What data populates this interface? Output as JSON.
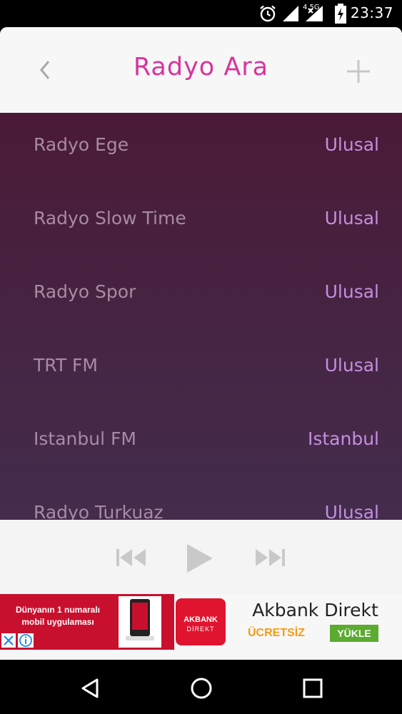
{
  "status_bar": {
    "time": "23:37",
    "network_label": "4.5G",
    "icons": [
      "alarm-icon",
      "signal-icon",
      "signal-icon",
      "battery-charging-icon"
    ]
  },
  "header": {
    "title": "Radyo Ara",
    "back_icon": "chevron-left-icon",
    "add_icon": "plus-icon"
  },
  "stations": [
    {
      "name": "Radyo Ege",
      "region": "Ulusal"
    },
    {
      "name": "Radyo Slow Time",
      "region": "Ulusal"
    },
    {
      "name": "Radyo Spor",
      "region": "Ulusal"
    },
    {
      "name": "TRT FM",
      "region": "Ulusal"
    },
    {
      "name": "Istanbul FM",
      "region": "Istanbul"
    },
    {
      "name": "Radyo Turkuaz",
      "region": "Ulusal"
    }
  ],
  "player": {
    "controls": [
      "previous-icon",
      "play-icon",
      "next-icon"
    ]
  },
  "ad": {
    "left_text_line1": "Dünyanın 1 numaralı",
    "left_text_line2": "mobil uygulaması",
    "logo_line1": "AKBANK",
    "logo_line2": "DİREKT",
    "brand": "Akbank Direkt",
    "free_label": "ÜCRETSİZ",
    "cta_label": "YÜKLE"
  },
  "nav_bar": {
    "buttons": [
      "back-triangle-icon",
      "home-circle-icon",
      "recents-square-icon"
    ]
  },
  "colors": {
    "accent": "#d8349e",
    "list_bg_top": "#4a1a37",
    "list_bg_bottom": "#442c4d",
    "station_name": "#a88aa4",
    "station_region": "#c48ee0",
    "ad_red": "#c8102e",
    "ad_green": "#5aab2f",
    "ad_orange": "#f39c12"
  }
}
